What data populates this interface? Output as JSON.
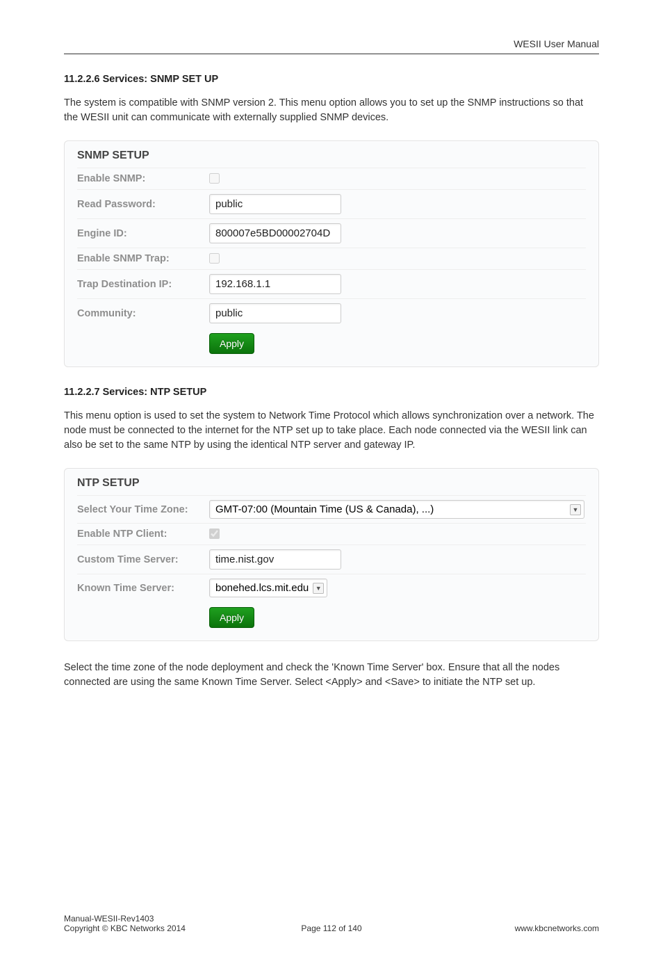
{
  "header": {
    "title": "WESII User Manual"
  },
  "section1": {
    "heading": "11.2.2.6 Services: SNMP SET UP",
    "para": "The system is compatible with SNMP version 2. This menu option allows you to set up the SNMP instructions so that the WESII unit can communicate with externally supplied SNMP devices."
  },
  "snmp": {
    "title": "SNMP SETUP",
    "rows": {
      "enable_snmp_label": "Enable SNMP:",
      "read_password_label": "Read Password:",
      "read_password_value": "public",
      "engine_id_label": "Engine ID:",
      "engine_id_value": "800007e5BD00002704D",
      "enable_trap_label": "Enable SNMP Trap:",
      "trap_ip_label": "Trap Destination IP:",
      "trap_ip_value": "192.168.1.1",
      "community_label": "Community:",
      "community_value": "public"
    },
    "apply": "Apply"
  },
  "section2": {
    "heading": "11.2.2.7 Services: NTP SETUP",
    "para": "This menu option is used to set the system to Network Time Protocol which allows synchronization over a network. The node must be connected to the internet for the NTP set up to take place. Each node connected via the WESII link can also be set to the same NTP by using the identical NTP server and gateway IP."
  },
  "ntp": {
    "title": "NTP SETUP",
    "rows": {
      "tz_label": "Select Your Time Zone:",
      "tz_value": "GMT-07:00 (Mountain Time (US & Canada), ...)",
      "enable_client_label": "Enable NTP Client:",
      "custom_server_label": "Custom Time Server:",
      "custom_server_value": "time.nist.gov",
      "known_server_label": "Known Time Server:",
      "known_server_value": "bonehed.lcs.mit.edu"
    },
    "apply": "Apply"
  },
  "closing_para": "Select the time zone of the node deployment and check the 'Known Time Server' box. Ensure that all the nodes connected are using the same Known Time Server. Select <Apply> and <Save> to initiate the NTP set up.",
  "footer": {
    "left1": "Manual-WESII-Rev1403",
    "left2": "Copyright © KBC Networks 2014",
    "mid": "Page 112 of 140",
    "right": "www.kbcnetworks.com"
  }
}
